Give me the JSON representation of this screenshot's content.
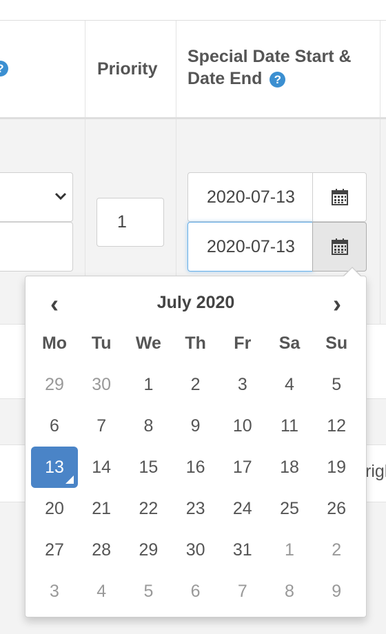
{
  "table": {
    "headers": {
      "priority": "Priority",
      "special_date_line1": "Special Date Start &",
      "special_date_line2": "Date End",
      "help_icon": "?"
    },
    "row": {
      "priority_value": "1",
      "date_start_value": "2020-07-13",
      "date_end_value": "2020-07-13",
      "cut_text": "righ"
    }
  },
  "datepicker": {
    "prev": "‹",
    "next": "›",
    "title": "July 2020",
    "weekdays": [
      "Mo",
      "Tu",
      "We",
      "Th",
      "Fr",
      "Sa",
      "Su"
    ],
    "weeks": [
      [
        "29",
        "30",
        "1",
        "2",
        "3",
        "4",
        "5"
      ],
      [
        "6",
        "7",
        "8",
        "9",
        "10",
        "11",
        "12"
      ],
      [
        "13",
        "14",
        "15",
        "16",
        "17",
        "18",
        "19"
      ],
      [
        "20",
        "21",
        "22",
        "23",
        "24",
        "25",
        "26"
      ],
      [
        "27",
        "28",
        "29",
        "30",
        "31",
        "1",
        "2"
      ],
      [
        "3",
        "4",
        "5",
        "6",
        "7",
        "8",
        "9"
      ]
    ],
    "selected_day": "13",
    "colors": {
      "selected": "#4a84c7",
      "help": "#3b8fd1",
      "focus": "#66afe9"
    }
  },
  "icons": [
    "help-icon",
    "calendar-icon",
    "chevron-down-icon",
    "prev-arrow-icon",
    "next-arrow-icon"
  ]
}
